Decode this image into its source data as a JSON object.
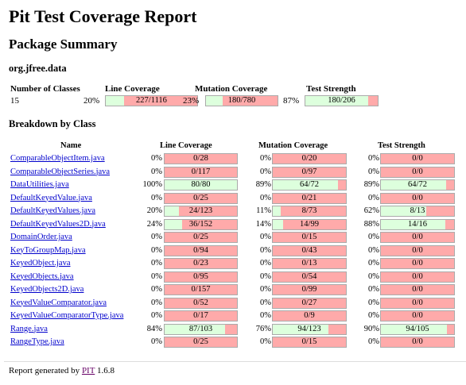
{
  "title": "Pit Test Coverage Report",
  "package_summary_title": "Package Summary",
  "package_name": "org.jfree.data",
  "summary": {
    "headers": {
      "classes": "Number of Classes",
      "line": "Line Coverage",
      "mutation": "Mutation Coverage",
      "strength": "Test Strength"
    },
    "num_classes": "15",
    "line": {
      "pct": "20%",
      "text": "227/1116",
      "fraction": 0.2
    },
    "mutation": {
      "pct": "23%",
      "text": "180/780",
      "fraction": 0.23
    },
    "strength": {
      "pct": "87%",
      "text": "180/206",
      "fraction": 0.87
    }
  },
  "breakdown_title": "Breakdown by Class",
  "columns": {
    "name": "Name",
    "line": "Line Coverage",
    "mutation": "Mutation Coverage",
    "strength": "Test Strength"
  },
  "rows": [
    {
      "name": "ComparableObjectItem.java",
      "lp": "0%",
      "lt": "0/28",
      "lf": 0,
      "mp": "0%",
      "mt": "0/20",
      "mf": 0,
      "sp": "0%",
      "st": "0/0",
      "sf": 0
    },
    {
      "name": "ComparableObjectSeries.java",
      "lp": "0%",
      "lt": "0/117",
      "lf": 0,
      "mp": "0%",
      "mt": "0/97",
      "mf": 0,
      "sp": "0%",
      "st": "0/0",
      "sf": 0
    },
    {
      "name": "DataUtilities.java",
      "lp": "100%",
      "lt": "80/80",
      "lf": 1.0,
      "mp": "89%",
      "mt": "64/72",
      "mf": 0.89,
      "sp": "89%",
      "st": "64/72",
      "sf": 0.89
    },
    {
      "name": "DefaultKeyedValue.java",
      "lp": "0%",
      "lt": "0/25",
      "lf": 0,
      "mp": "0%",
      "mt": "0/21",
      "mf": 0,
      "sp": "0%",
      "st": "0/0",
      "sf": 0
    },
    {
      "name": "DefaultKeyedValues.java",
      "lp": "20%",
      "lt": "24/123",
      "lf": 0.2,
      "mp": "11%",
      "mt": "8/73",
      "mf": 0.11,
      "sp": "62%",
      "st": "8/13",
      "sf": 0.62
    },
    {
      "name": "DefaultKeyedValues2D.java",
      "lp": "24%",
      "lt": "36/152",
      "lf": 0.24,
      "mp": "14%",
      "mt": "14/99",
      "mf": 0.14,
      "sp": "88%",
      "st": "14/16",
      "sf": 0.88
    },
    {
      "name": "DomainOrder.java",
      "lp": "0%",
      "lt": "0/25",
      "lf": 0,
      "mp": "0%",
      "mt": "0/15",
      "mf": 0,
      "sp": "0%",
      "st": "0/0",
      "sf": 0
    },
    {
      "name": "KeyToGroupMap.java",
      "lp": "0%",
      "lt": "0/94",
      "lf": 0,
      "mp": "0%",
      "mt": "0/43",
      "mf": 0,
      "sp": "0%",
      "st": "0/0",
      "sf": 0
    },
    {
      "name": "KeyedObject.java",
      "lp": "0%",
      "lt": "0/23",
      "lf": 0,
      "mp": "0%",
      "mt": "0/13",
      "mf": 0,
      "sp": "0%",
      "st": "0/0",
      "sf": 0
    },
    {
      "name": "KeyedObjects.java",
      "lp": "0%",
      "lt": "0/95",
      "lf": 0,
      "mp": "0%",
      "mt": "0/54",
      "mf": 0,
      "sp": "0%",
      "st": "0/0",
      "sf": 0
    },
    {
      "name": "KeyedObjects2D.java",
      "lp": "0%",
      "lt": "0/157",
      "lf": 0,
      "mp": "0%",
      "mt": "0/99",
      "mf": 0,
      "sp": "0%",
      "st": "0/0",
      "sf": 0
    },
    {
      "name": "KeyedValueComparator.java",
      "lp": "0%",
      "lt": "0/52",
      "lf": 0,
      "mp": "0%",
      "mt": "0/27",
      "mf": 0,
      "sp": "0%",
      "st": "0/0",
      "sf": 0
    },
    {
      "name": "KeyedValueComparatorType.java",
      "lp": "0%",
      "lt": "0/17",
      "lf": 0,
      "mp": "0%",
      "mt": "0/9",
      "mf": 0,
      "sp": "0%",
      "st": "0/0",
      "sf": 0
    },
    {
      "name": "Range.java",
      "lp": "84%",
      "lt": "87/103",
      "lf": 0.84,
      "mp": "76%",
      "mt": "94/123",
      "mf": 0.76,
      "sp": "90%",
      "st": "94/105",
      "sf": 0.9
    },
    {
      "name": "RangeType.java",
      "lp": "0%",
      "lt": "0/25",
      "lf": 0,
      "mp": "0%",
      "mt": "0/15",
      "mf": 0,
      "sp": "0%",
      "st": "0/0",
      "sf": 0
    }
  ],
  "footer": {
    "prefix": "Report generated by ",
    "link": "PIT",
    "version": " 1.6.8"
  },
  "colors": {
    "covered": "#ddffdd",
    "uncovered": "#ffaaaa",
    "link": "#0000cc"
  }
}
